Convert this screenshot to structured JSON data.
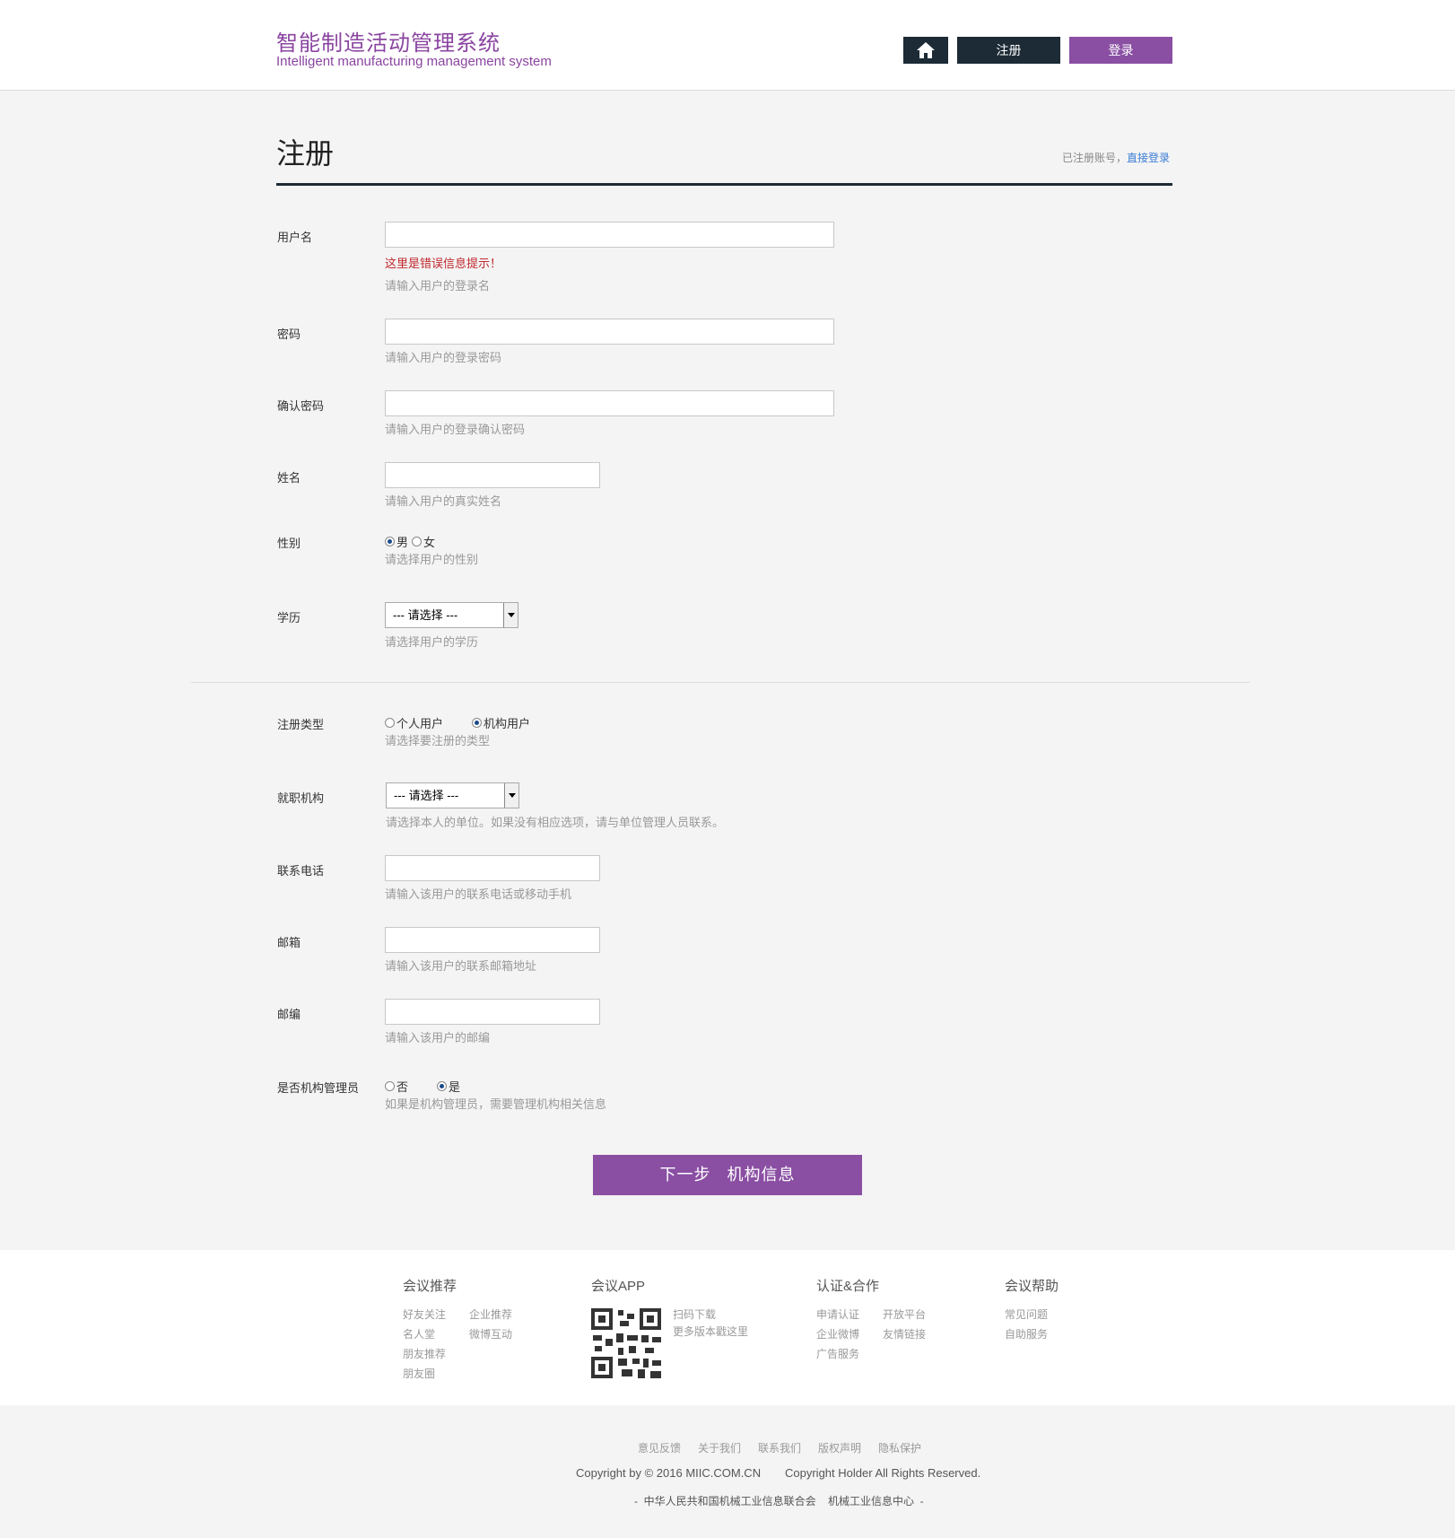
{
  "header": {
    "brand_cn": "智能制造活动管理系统",
    "brand_en": "Intelligent manufacturing management system",
    "register_label": "注册",
    "login_label": "登录"
  },
  "page": {
    "title": "注册",
    "already_text": "已注册账号，",
    "direct_login": "直接登录"
  },
  "form": {
    "username": {
      "label": "用户名",
      "value": "",
      "error": "这里是错误信息提示！",
      "hint": "请输入用户的登录名"
    },
    "password": {
      "label": "密码",
      "value": "",
      "hint": "请输入用户的登录密码"
    },
    "confirm_password": {
      "label": "确认密码",
      "value": "",
      "hint": "请输入用户的登录确认密码"
    },
    "name": {
      "label": "姓名",
      "value": "",
      "hint": "请输入用户的真实姓名"
    },
    "gender": {
      "label": "性别",
      "options": [
        "男",
        "女"
      ],
      "selected": "男",
      "hint": "请选择用户的性别"
    },
    "education": {
      "label": "学历",
      "selected": "--- 请选择 ---",
      "hint": "请选择用户的学历"
    },
    "reg_type": {
      "label": "注册类型",
      "options": [
        "个人用户",
        "机构用户"
      ],
      "selected": "机构用户",
      "hint": "请选择要注册的类型"
    },
    "institution": {
      "label": "就职机构",
      "selected": "--- 请选择 ---",
      "hint": "请选择本人的单位。如果没有相应选项，请与单位管理人员联系。"
    },
    "phone": {
      "label": "联系电话",
      "value": "",
      "hint": "请输入该用户的联系电话或移动手机"
    },
    "email": {
      "label": "邮箱",
      "value": "",
      "hint": "请输入该用户的联系邮箱地址"
    },
    "postcode": {
      "label": "邮编",
      "value": "",
      "hint": "请输入该用户的邮编"
    },
    "is_admin": {
      "label": "是否机构管理员",
      "options": [
        "否",
        "是"
      ],
      "selected": "是",
      "hint": "如果是机构管理员，需要管理机构相关信息"
    },
    "next_button": "下一步 机构信息"
  },
  "footer": {
    "col1": {
      "title": "会议推荐",
      "links": [
        "好友关注",
        "企业推荐",
        "名人堂",
        "微博互动",
        "朋友推荐",
        "朋友圈"
      ]
    },
    "col2": {
      "title": "会议APP",
      "links": [
        "扫码下载",
        "更多版本戳这里"
      ]
    },
    "col3": {
      "title": "认证&合作",
      "links": [
        "申请认证",
        "开放平台",
        "企业微博",
        "友情链接",
        "广告服务"
      ]
    },
    "col4": {
      "title": "会议帮助",
      "links": [
        "常见问题",
        "自助服务"
      ]
    },
    "bottom_links": [
      "意见反馈",
      "关于我们",
      "联系我们",
      "版权声明",
      "隐私保护"
    ],
    "copyright": "Copyright by © 2016 MIIC.COM.CN",
    "rights": "Copyright Holder All Rights Reserved.",
    "org_line": "-  中华人民共和国机械工业信息联合会    机械工业信息中心  -"
  }
}
